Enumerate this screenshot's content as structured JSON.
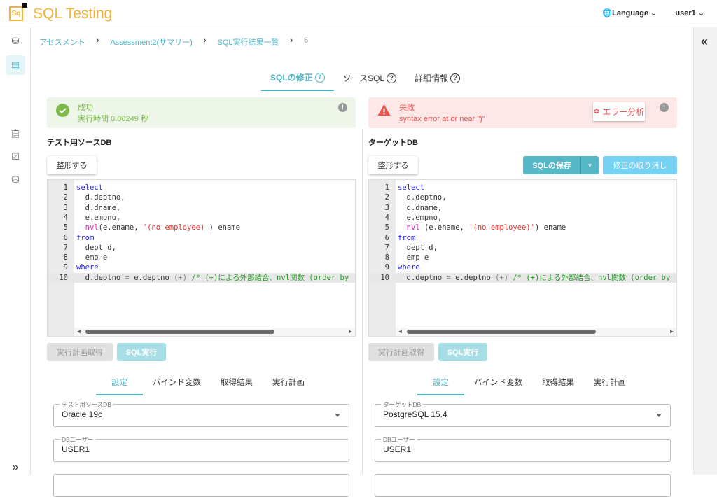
{
  "app": {
    "title": "SQL Testing",
    "logo_text": "Sq"
  },
  "header": {
    "language": "Language",
    "user": "user1"
  },
  "breadcrumb": [
    "アセスメント",
    "Assessment2(サマリー)",
    "SQL実行結果一覧",
    "6"
  ],
  "tabs": [
    {
      "label": "SQLの修正",
      "active": true
    },
    {
      "label": "ソースSQL"
    },
    {
      "label": "詳細情報"
    }
  ],
  "left": {
    "status": {
      "title": "成功",
      "detail": "実行時間 0.00249 秒",
      "color": "#7dbb49"
    },
    "heading": "テスト用ソースDB",
    "format_button": "整形する",
    "code": [
      [
        [
          "kw",
          "select"
        ]
      ],
      [
        [
          "",
          "  d.deptno,"
        ]
      ],
      [
        [
          "",
          "  d.dname,"
        ]
      ],
      [
        [
          "",
          "  e.empno,"
        ]
      ],
      [
        [
          "",
          "  "
        ],
        [
          "fn",
          "nvl"
        ],
        [
          "",
          "(e.ename, "
        ],
        [
          "str",
          "'(no employee)'"
        ],
        [
          "",
          ") ename"
        ]
      ],
      [
        [
          "kw",
          "from"
        ]
      ],
      [
        [
          "",
          "  dept d,"
        ]
      ],
      [
        [
          "",
          "  emp e"
        ]
      ],
      [
        [
          "kw",
          "where"
        ]
      ],
      [
        [
          "",
          "  d.deptno "
        ],
        [
          "op",
          "="
        ],
        [
          "",
          " e.deptno "
        ],
        [
          "op",
          "(+)"
        ],
        [
          "cm",
          " /* (+)による外部結合、nvl関数 (order by"
        ]
      ]
    ],
    "plan_button": "実行計画取得",
    "run_button": "SQL実行",
    "subtabs": [
      "設定",
      "バインド変数",
      "取得結果",
      "実行計画"
    ],
    "db_label": "テスト用ソースDB",
    "db_value": "Oracle 19c",
    "user_label": "DBユーザー",
    "user_value": "USER1"
  },
  "right": {
    "status": {
      "title": "失敗",
      "detail": "syntax error at or near \")\"",
      "color": "#ef5350"
    },
    "error_analysis_button": "エラー分析",
    "heading": "ターゲットDB",
    "format_button": "整形する",
    "save_button": "SQLの保存",
    "undo_button": "修正の取り消し",
    "code": [
      [
        [
          "kw",
          "select"
        ]
      ],
      [
        [
          "",
          "  d.deptno,"
        ]
      ],
      [
        [
          "",
          "  d.dname,"
        ]
      ],
      [
        [
          "",
          "  e.empno,"
        ]
      ],
      [
        [
          "",
          "  "
        ],
        [
          "fn",
          "nvl"
        ],
        [
          "",
          " (e.ename, "
        ],
        [
          "str",
          "'(no employee)'"
        ],
        [
          "",
          ") ename"
        ]
      ],
      [
        [
          "kw",
          "from"
        ]
      ],
      [
        [
          "",
          "  dept d,"
        ]
      ],
      [
        [
          "",
          "  emp e"
        ]
      ],
      [
        [
          "kw",
          "where"
        ]
      ],
      [
        [
          "",
          "  d.deptno "
        ],
        [
          "op",
          "="
        ],
        [
          "",
          " e.deptno "
        ],
        [
          "op",
          "(+)"
        ],
        [
          "cm",
          " /* (+)による外部結合、nvl関数 (order by"
        ]
      ]
    ],
    "plan_button": "実行計画取得",
    "run_button": "SQL実行",
    "subtabs": [
      "設定",
      "バインド変数",
      "取得結果",
      "実行計画"
    ],
    "db_label": "ターゲットDB",
    "db_value": "PostgreSQL 15.4",
    "user_label": "DBユーザー",
    "user_value": "USER1"
  },
  "info_icon": "!"
}
